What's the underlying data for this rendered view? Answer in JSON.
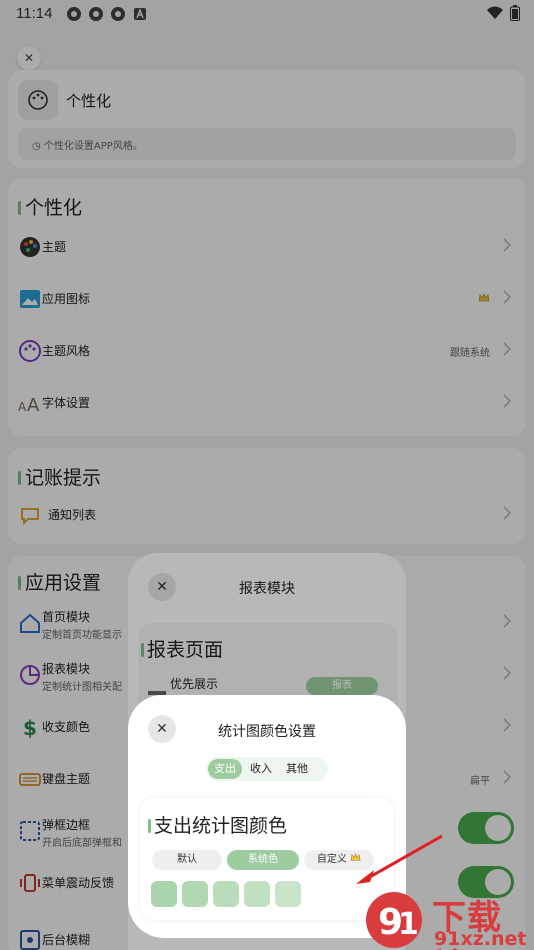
{
  "status_bar": {
    "time": "11:14"
  },
  "header": {
    "title": "个性化",
    "description": "个性化设置APP风格。"
  },
  "sections": {
    "personalization": {
      "title": "个性化",
      "items": [
        {
          "label": "主题"
        },
        {
          "label": "应用图标"
        },
        {
          "label": "主题风格",
          "value": "跟随系统"
        },
        {
          "label": "字体设置"
        }
      ]
    },
    "reminder": {
      "title": "记账提示",
      "items": [
        {
          "label": "通知列表"
        }
      ]
    },
    "app_settings": {
      "title": "应用设置",
      "items": [
        {
          "label": "首页模块",
          "sub": "定制首页功能显示"
        },
        {
          "label": "报表模块",
          "sub": "定制统计图相关配"
        },
        {
          "label": "收支颜色"
        },
        {
          "label": "键盘主题",
          "value": "扁平"
        },
        {
          "label": "弹框边框",
          "sub": "开启后底部弹框和"
        },
        {
          "label": "菜单震动反馈"
        },
        {
          "label": "后台模糊"
        }
      ]
    }
  },
  "report_sheet": {
    "title": "报表模块",
    "section_title": "报表页面",
    "row_label": "优先展示",
    "row_value": "报表"
  },
  "color_sheet": {
    "title": "统计图颜色设置",
    "tabs": [
      "支出",
      "收入",
      "其他"
    ],
    "section_title": "支出统计图颜色",
    "chips": [
      "默认",
      "系统色",
      "自定义"
    ],
    "swatch_colors": [
      "#a8d5ab",
      "#b0d9b2",
      "#b9ddbb",
      "#c2e1c3",
      "#cae4cb"
    ]
  },
  "watermark": {
    "brand": "下载站",
    "url": "91xz.net"
  }
}
